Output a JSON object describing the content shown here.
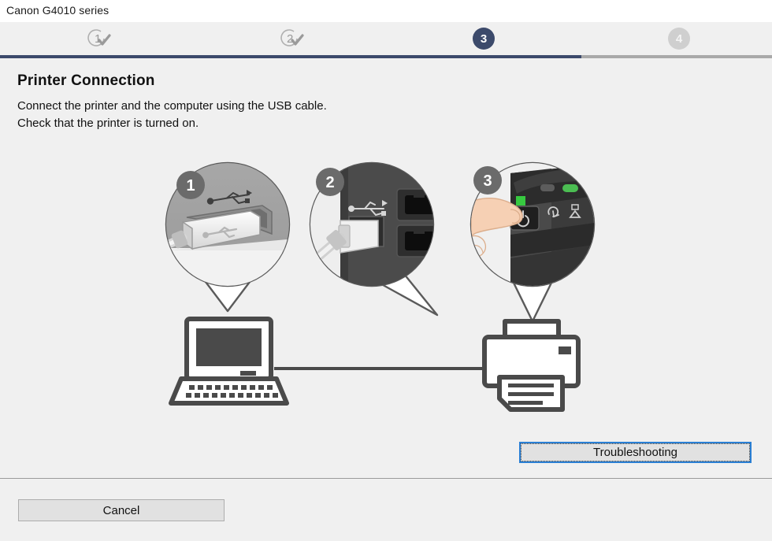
{
  "window": {
    "title": "Canon G4010 series",
    "background_color": "#f0f0f0",
    "titlebar_color": "#ffffff"
  },
  "stepper": {
    "accent_color": "#3c4a6b",
    "inactive_color": "#cfcfcf",
    "track_color": "#a9a9a9",
    "progress_percent": 75,
    "steps": [
      {
        "number": "1",
        "state": "completed"
      },
      {
        "number": "2",
        "state": "completed"
      },
      {
        "number": "3",
        "state": "active"
      },
      {
        "number": "4",
        "state": "upcoming"
      }
    ]
  },
  "content": {
    "heading": "Printer Connection",
    "description_line1": "Connect the printer and the computer using the USB cable.",
    "description_line2": "Check that the printer is turned on."
  },
  "illustration": {
    "callout_1_badge": "1",
    "callout_1_caption": "USB cable connector plugging into computer USB port",
    "callout_2_badge": "2",
    "callout_2_caption": "USB cable plugged into printer rear USB port next to phone jacks",
    "callout_3_badge": "3",
    "callout_3_caption": "Hand pressing the printer power button on the control panel",
    "device_left": "laptop computer",
    "device_right": "printer",
    "power_led_color": "#37c940",
    "power_button_green": "#4bbd52",
    "power_button_orange": "#e06b3b"
  },
  "buttons": {
    "troubleshooting": "Troubleshooting",
    "cancel": "Cancel",
    "focus_border_color": "#2a7fd4",
    "face_color": "#e1e1e1"
  }
}
